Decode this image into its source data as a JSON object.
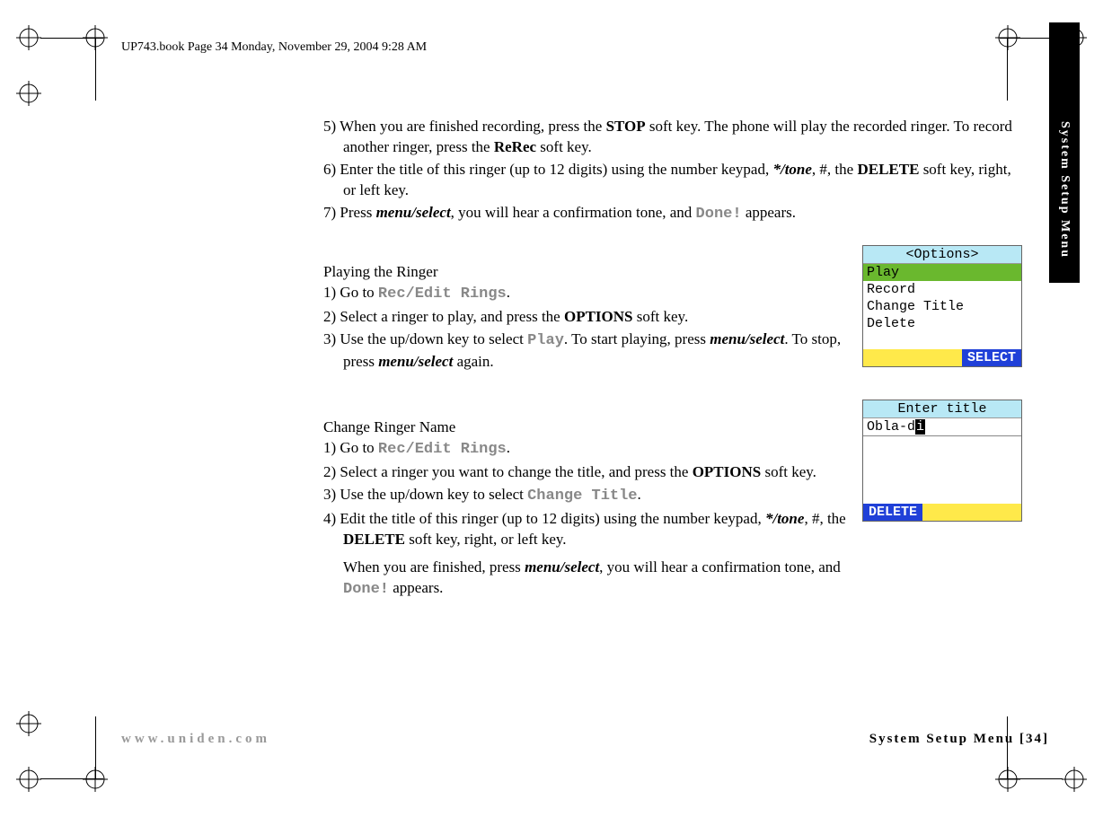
{
  "header": "UP743.book  Page 34  Monday, November 29, 2004  9:28 AM",
  "tab_label": "System Setup Menu",
  "steps_top": {
    "s5_a": "5) When you are finished recording, press the ",
    "s5_stop": "STOP",
    "s5_b": " soft key. The phone will play the recorded ringer. To record another ringer, press the ",
    "s5_rerec": "ReRec",
    "s5_c": " soft key.",
    "s6_a": "6) Enter the title of this ringer (up to 12 digits) using the number keypad, ",
    "s6_tone": "*/tone",
    "s6_b": ", #, the ",
    "s6_delete": "DELETE",
    "s6_c": " soft key, right, or left key.",
    "s7_a": "7) Press ",
    "s7_menu": "menu/select",
    "s7_b": ", you will hear a confirmation tone, and ",
    "s7_done": "Done!",
    "s7_c": " appears."
  },
  "playing": {
    "title": "Playing the Ringer",
    "s1_a": "1) Go to ",
    "s1_lcd": "Rec/Edit Rings",
    "s1_b": ".",
    "s2_a": "2) Select a ringer to play, and press the ",
    "s2_options": "OPTIONS",
    "s2_b": " soft key.",
    "s3_a": "3) Use the up/down key to select ",
    "s3_lcd": "Play",
    "s3_b": ". To start playing, press ",
    "s3_menu": "menu/select",
    "s3_c": ". To stop, press ",
    "s3_menu2": "menu/select",
    "s3_d": " again."
  },
  "change": {
    "title": "Change Ringer Name",
    "s1_a": "1) Go to ",
    "s1_lcd": "Rec/Edit Rings",
    "s1_b": ".",
    "s2_a": "2) Select a ringer you want to change the title, and press the ",
    "s2_options": "OPTIONS",
    "s2_b": " soft key.",
    "s3_a": "3) Use the up/down key to select ",
    "s3_lcd": "Change Title",
    "s3_b": ".",
    "s4_a": "4) Edit the title of this ringer (up to 12 digits) using the number keypad, ",
    "s4_tone": "*/tone",
    "s4_b": ", #, the ",
    "s4_delete": "DELETE",
    "s4_c": " soft key, right, or left key.",
    "finish_a": "When you are finished, press ",
    "finish_menu": "menu/select",
    "finish_b": ", you will hear a confirmation tone, and ",
    "finish_done": "Done!",
    "finish_c": " appears."
  },
  "screen1": {
    "title": "<Options>",
    "row1": "Play",
    "row2": "Record",
    "row3": "Change Title",
    "row4": "Delete",
    "softkey": "SELECT"
  },
  "screen2": {
    "title": "Enter title",
    "input_prefix": "Obla-d",
    "input_cursor": "i",
    "softkey": "DELETE"
  },
  "footer": {
    "url": "www.uniden.com",
    "section": "System Setup Menu [34]"
  }
}
